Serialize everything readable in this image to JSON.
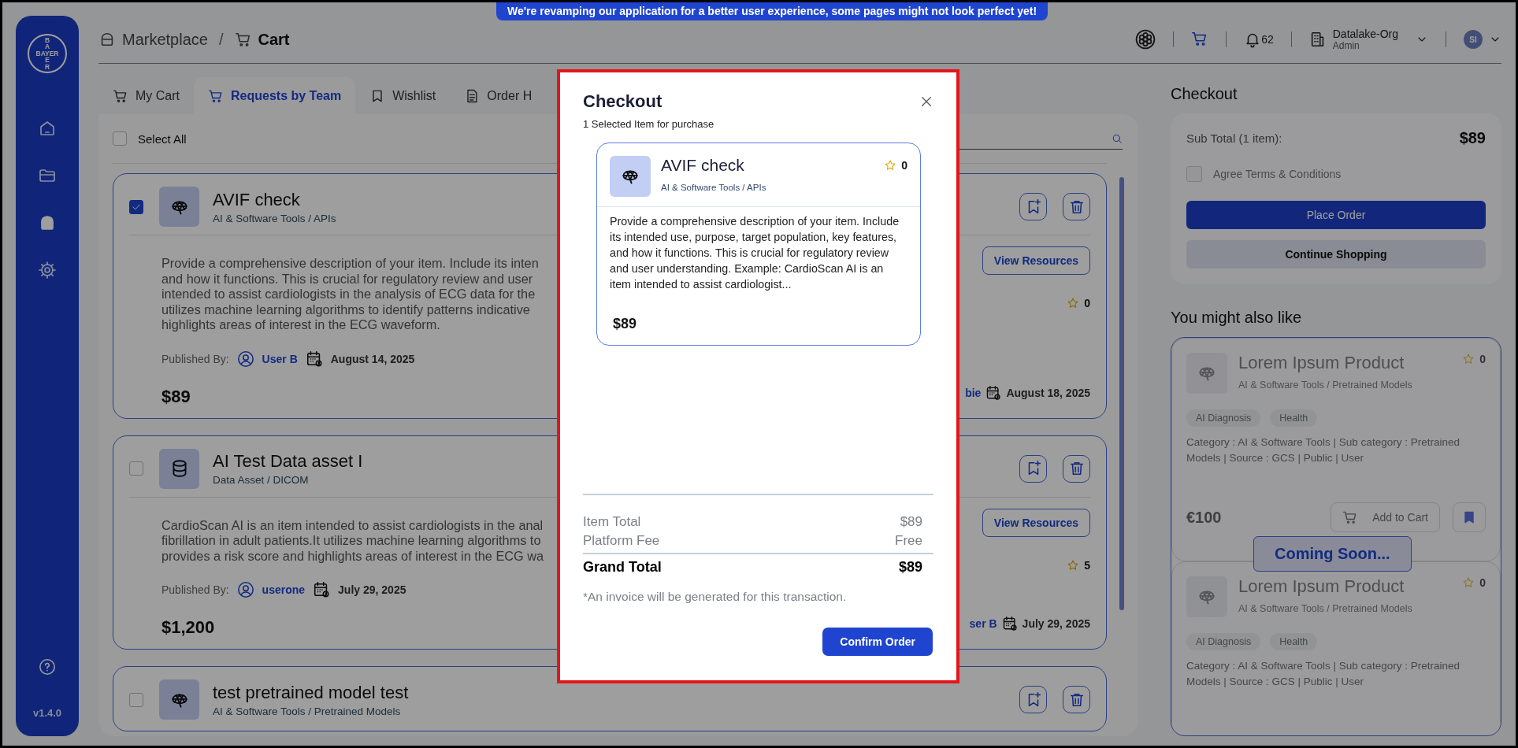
{
  "banner": "We're revamping our application for a better user experience, some pages might not look perfect yet!",
  "sidebar": {
    "logo": {
      "down_top": "BA",
      "across": "BAYER",
      "down_bottom": "ER"
    },
    "items": [
      {
        "kind": "home",
        "selected": false
      },
      {
        "kind": "folder",
        "selected": false
      },
      {
        "kind": "bag",
        "selected": true
      },
      {
        "kind": "gear",
        "selected": false
      }
    ],
    "version": "v1.4.0"
  },
  "breadcrumb": {
    "separator": "/",
    "items": [
      {
        "kind": "bag",
        "label": "Marketplace",
        "current": false
      },
      {
        "kind": "cart",
        "label": "Cart",
        "current": true
      }
    ]
  },
  "header": {
    "notifications": "62",
    "org": {
      "name": "Datalake-Org",
      "role": "Admin"
    },
    "avatar": "SI"
  },
  "tabs": [
    {
      "kind": "cart",
      "label": "My Cart",
      "selected": false
    },
    {
      "kind": "cart",
      "label": "Requests by Team",
      "selected": true
    },
    {
      "kind": "bookmark",
      "label": "Wishlist",
      "selected": false
    },
    {
      "kind": "document",
      "label": "Order H",
      "selected": false
    }
  ],
  "select_all": {
    "label": "Select All",
    "checked": false
  },
  "cart_items": [
    {
      "kind": "model",
      "checked": true,
      "title": "AVIF check",
      "category": "AI & Software Tools / APIs",
      "description_lines": [
        "Provide a comprehensive description of your item. Include its inten",
        "and how it functions. This is crucial for regulatory review and user",
        "intended to assist cardiologists in the analysis of ECG data for the",
        "utilizes machine learning algorithms to identify patterns indicative",
        "highlights areas of interest in the ECG waveform."
      ],
      "published_label": "Published By:",
      "author": "User B",
      "date": "August 14, 2025",
      "price": "$89",
      "resources_button": "View Resources",
      "rating": "0",
      "author_fragment": "bie",
      "date_right": "August 18, 2025"
    },
    {
      "kind": "data",
      "checked": false,
      "title": "AI Test Data asset I",
      "category": "Data Asset / DICOM",
      "description_lines": [
        "CardioScan AI is an item intended to assist cardiologists in the anal",
        "fibrillation in adult patients.It utilizes machine learning algorithms to",
        "provides a risk score and highlights areas of interest in the ECG wa"
      ],
      "published_label": "Published By:",
      "author": "userone",
      "date": "July 29, 2025",
      "price": "$1,200",
      "resources_button": "View Resources",
      "rating": "5",
      "author_fragment": "ser B",
      "date_right": "July 29, 2025"
    },
    {
      "kind": "model",
      "checked": false,
      "title": "test pretrained model test",
      "category": "AI & Software Tools / Pretrained Models"
    }
  ],
  "checkout": {
    "title": "Checkout",
    "subtotal_label": "Sub Total (1 item):",
    "subtotal": "$89",
    "terms": {
      "label": "Agree Terms & Conditions",
      "checked": false
    },
    "place_order": "Place Order",
    "continue_shopping": "Continue Shopping"
  },
  "recommendations": {
    "title": "You might also like",
    "overlay": "Coming Soon...",
    "products": [
      {
        "title": "Lorem Ipsum Product",
        "category": "AI & Software Tools / Pretrained Models",
        "rating": "0",
        "tags": [
          "AI Diagnosis",
          "Health"
        ],
        "details": "Category : AI & Software Tools | Sub category : Pretrained Models | Source : GCS | Public | User",
        "price": "€100",
        "add_to_cart": "Add to Cart"
      },
      {
        "title": "Lorem Ipsum Product",
        "category": "AI & Software Tools / Pretrained Models",
        "rating": "0",
        "tags": [
          "AI Diagnosis",
          "Health"
        ],
        "details": "Category : AI & Software Tools | Sub category : Pretrained Models | Source : GCS | Public | User"
      }
    ]
  },
  "modal": {
    "title": "Checkout",
    "subtitle": "1 Selected Item for purchase",
    "item": {
      "kind": "model",
      "title": "AVIF check",
      "category": "AI & Software Tools / APIs",
      "rating": "0",
      "description": "Provide a comprehensive description of your item. Include its intended use, purpose, target population, key features, and how it functions. This is crucial for regulatory review and user understanding. Example: CardioScan AI is an item intended to assist cardiologist...",
      "price": "$89"
    },
    "summary": [
      {
        "kind": "line",
        "label": "Item Total",
        "value": "$89"
      },
      {
        "kind": "line",
        "label": "Platform Fee",
        "value": "Free"
      },
      {
        "kind": "total",
        "label": "Grand Total",
        "value": "$89"
      }
    ],
    "note": "*An invoice will be generated for this transaction.",
    "confirm": "Confirm Order"
  }
}
